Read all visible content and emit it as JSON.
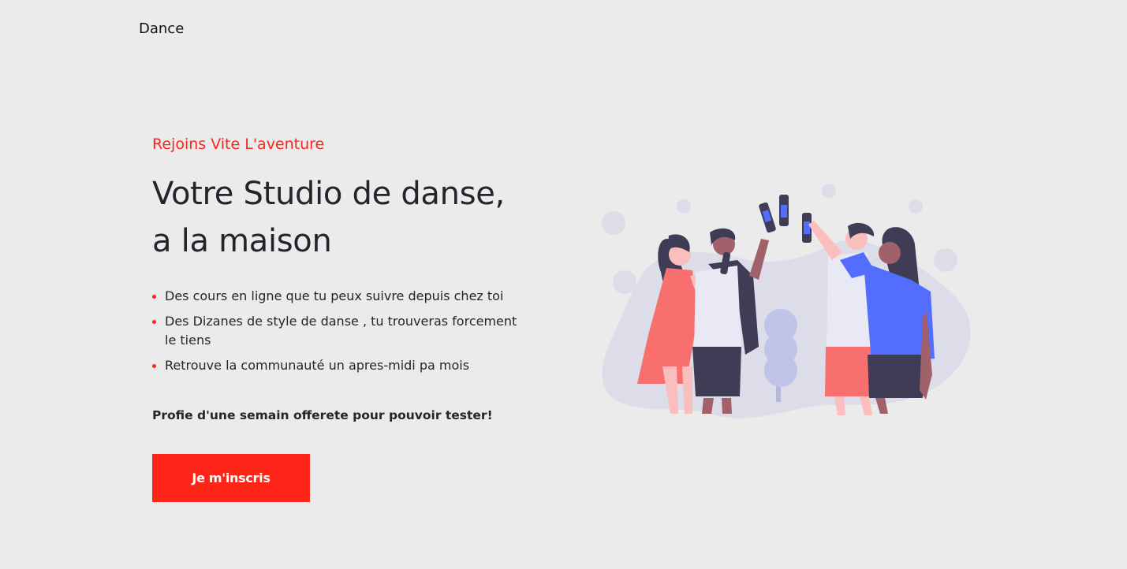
{
  "nav": {
    "logo": "Dance"
  },
  "hero": {
    "kicker": "Rejoins Vite L'aventure",
    "headline_line1": "Votre Studio de danse,",
    "headline_line2": "a la maison",
    "features": [
      "Des cours en ligne que tu peux suivre depuis chez toi",
      "Des Dizanes de style de danse , tu trouveras forcement le tiens",
      "Retrouve la communauté un apres-midi pa mois"
    ],
    "offer": "Profie d'une semain offerete pour pouvoir tester!",
    "cta_label": "Je m'inscris"
  },
  "colors": {
    "accent": "#ff2418",
    "background": "#ebebeb",
    "text": "#24242c",
    "blob": "#dcdde9",
    "blue": "#536dfe",
    "coral": "#f86f6f"
  }
}
